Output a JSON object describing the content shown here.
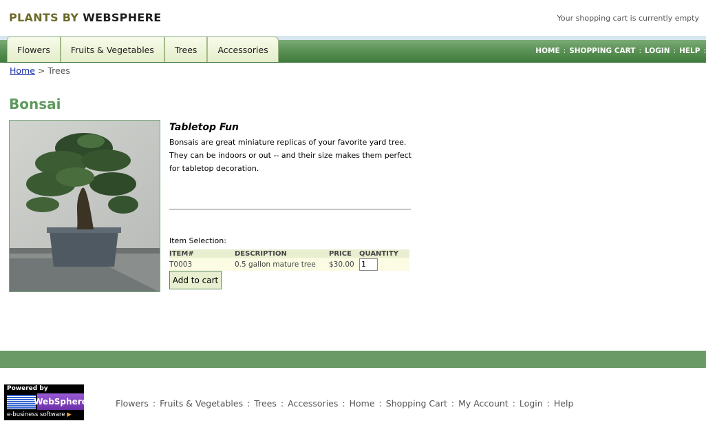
{
  "header": {
    "logo_part1": "PLANTS BY",
    "logo_part2": "WEBSPHERE",
    "cart_status": "Your shopping cart is currently empty"
  },
  "tabs": [
    {
      "label": "Flowers"
    },
    {
      "label": "Fruits & Vegetables"
    },
    {
      "label": "Trees"
    },
    {
      "label": "Accessories"
    }
  ],
  "topnav": [
    {
      "label": "HOME"
    },
    {
      "label": "SHOPPING CART"
    },
    {
      "label": "LOGIN"
    },
    {
      "label": "HELP"
    }
  ],
  "breadcrumb": {
    "home": "Home",
    "separator": ">",
    "current": "Trees"
  },
  "product": {
    "name": "Bonsai",
    "tagline": "Tabletop Fun",
    "description": "Bonsais are great miniature replicas of your favorite yard tree. They can be indoors or out -- and their size makes them perfect for tabletop decoration.",
    "image_icon": "bonsai-photo",
    "selection_label": "Item Selection:",
    "columns": [
      "ITEM#",
      "DESCRIPTION",
      "PRICE",
      "QUANTITY"
    ],
    "items": [
      {
        "item": "T0003",
        "description": "0.5 gallon mature tree",
        "price": "$30.00",
        "quantity": "1"
      }
    ],
    "add_to_cart": "Add to cart"
  },
  "badge": {
    "powered_by": "Powered by",
    "ibm": "IBM",
    "websphere": "WebSphere",
    "ebusiness": "e-business software"
  },
  "footnav": [
    {
      "label": "Flowers"
    },
    {
      "label": "Fruits & Vegetables"
    },
    {
      "label": "Trees"
    },
    {
      "label": "Accessories"
    },
    {
      "label": "Home"
    },
    {
      "label": "Shopping Cart"
    },
    {
      "label": "My Account"
    },
    {
      "label": "Login"
    },
    {
      "label": "Help"
    }
  ],
  "colors": {
    "brand_green": "#5e9a5e",
    "nav_green": "#5c9257",
    "link_blue": "#1a2fa6"
  }
}
